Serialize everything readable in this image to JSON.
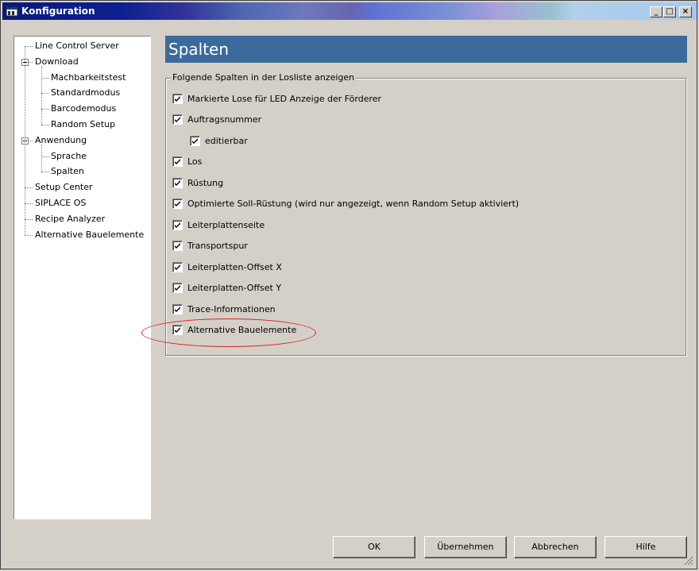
{
  "window": {
    "title": "Konfiguration"
  },
  "title_buttons": {
    "minimize": "_",
    "maximize": "□",
    "close": "×"
  },
  "tree": {
    "items": [
      {
        "label": "Line Control Server",
        "level": 0,
        "expander": "none"
      },
      {
        "label": "Download",
        "level": 0,
        "expander": "collapse"
      },
      {
        "label": "Machbarkeitstest",
        "level": 1,
        "expander": "none"
      },
      {
        "label": "Standardmodus",
        "level": 1,
        "expander": "none"
      },
      {
        "label": "Barcodemodus",
        "level": 1,
        "expander": "none"
      },
      {
        "label": "Random Setup",
        "level": 1,
        "expander": "none"
      },
      {
        "label": "Anwendung",
        "level": 0,
        "expander": "collapse"
      },
      {
        "label": "Sprache",
        "level": 1,
        "expander": "none"
      },
      {
        "label": "Spalten",
        "level": 1,
        "expander": "none"
      },
      {
        "label": "Setup Center",
        "level": 0,
        "expander": "none"
      },
      {
        "label": "SIPLACE OS",
        "level": 0,
        "expander": "none"
      },
      {
        "label": "Recipe Analyzer",
        "level": 0,
        "expander": "none"
      },
      {
        "label": "Alternative Bauelemente",
        "level": 0,
        "expander": "none"
      }
    ]
  },
  "panel": {
    "title": "Spalten",
    "group_label": "Folgende Spalten in der Losliste anzeigen",
    "checkboxes": [
      {
        "label": "Markierte Lose für LED Anzeige der Förderer",
        "checked": true,
        "indent": 0
      },
      {
        "label": "Auftragsnummer",
        "checked": true,
        "indent": 0
      },
      {
        "label": "editierbar",
        "checked": true,
        "indent": 1
      },
      {
        "label": "Los",
        "checked": true,
        "indent": 0
      },
      {
        "label": "Rüstung",
        "checked": true,
        "indent": 0
      },
      {
        "label": "Optimierte Soll-Rüstung (wird nur angezeigt, wenn Random Setup aktiviert)",
        "checked": true,
        "indent": 0
      },
      {
        "label": "Leiterplattenseite",
        "checked": true,
        "indent": 0
      },
      {
        "label": "Transportspur",
        "checked": true,
        "indent": 0
      },
      {
        "label": "Leiterplatten-Offset X",
        "checked": true,
        "indent": 0
      },
      {
        "label": "Leiterplatten-Offset Y",
        "checked": true,
        "indent": 0
      },
      {
        "label": "Trace-Informationen",
        "checked": true,
        "indent": 0
      },
      {
        "label": "Alternative Bauelemente",
        "checked": true,
        "indent": 0
      }
    ]
  },
  "buttons": {
    "ok": "OK",
    "apply": "Übernehmen",
    "cancel": "Abbrechen",
    "help": "Hilfe"
  },
  "colors": {
    "header_bg": "#3c6a9c",
    "annotation": "#d82020",
    "face": "#d4d0c8"
  }
}
